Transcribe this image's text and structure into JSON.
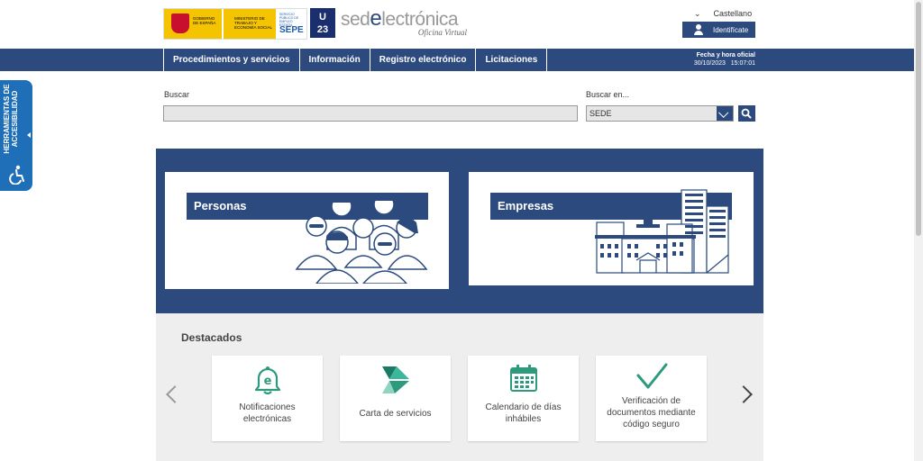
{
  "header": {
    "gov_logo_text": "GOBIERNO DE ESPAÑA",
    "ministry_text": "MINISTERIO DE TRABAJO Y ECONOMÍA SOCIAL",
    "sepe_small": "SERVICIO PÚBLICO DE EMPLEO ESTATAL",
    "sepe_label": "SEPE",
    "u23_top": "U",
    "u23_bottom": "23",
    "sede_prefix": "sed",
    "sede_e": "e",
    "sede_suffix": "lectrónica",
    "sede_sub": "Oficina Virtual",
    "language": "Castellano",
    "login_label": "Identifícate"
  },
  "nav": {
    "items": [
      "Procedimientos y servicios",
      "Información",
      "Registro electrónico",
      "Licitaciones"
    ]
  },
  "datetime": {
    "label": "Fecha y hora oficial",
    "value": "30/10/2023",
    "time": "15:07:01"
  },
  "accessibility": {
    "line1": "HERRAMIENTAS DE",
    "line2": "ACCESIBILIDAD"
  },
  "search": {
    "label": "Buscar",
    "value": "",
    "in_label": "Buscar en...",
    "in_value": "SEDE"
  },
  "hero": {
    "personas": "Personas",
    "empresas": "Empresas"
  },
  "destacados": {
    "title": "Destacados",
    "cards": [
      {
        "line1": "Notificaciones",
        "line2": "electrónicas",
        "line3": "",
        "icon": "bell-notification-icon"
      },
      {
        "line1": "Carta de servicios",
        "line2": "",
        "line3": "",
        "icon": "sepe-logo-icon"
      },
      {
        "line1": "Calendario de días",
        "line2": "inhábiles",
        "line3": "",
        "icon": "calendar-icon"
      },
      {
        "line1": "Verificación de",
        "line2": "documentos mediante",
        "line3": "código seguro",
        "icon": "checkmark-icon"
      }
    ]
  },
  "colors": {
    "primary": "#2c4a7e",
    "accent_green": "#2d9a7e",
    "accessibility_blue": "#1f6fb8"
  }
}
